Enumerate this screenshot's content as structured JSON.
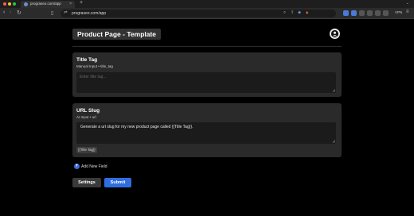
{
  "browser": {
    "tab_title": "prograseo.com/app",
    "tab_close": "×",
    "new_tab": "+",
    "url": "prograseo.com/app",
    "vpn_label": "VPN",
    "traffic_lights": [
      "#ff5f57",
      "#febc2e",
      "#28c840"
    ]
  },
  "page": {
    "title": "Product Page - Template"
  },
  "cards": [
    {
      "label": "Title Tag",
      "subtitle": "Manual Input • title_tag",
      "placeholder": "Enter title tag...",
      "value": ""
    },
    {
      "label": "URL Slug",
      "subtitle": "AI Input • url",
      "value": "Generate a url slug for my new product page called {{Title Tag}}.",
      "chip": "{{Title Tag}}"
    }
  ],
  "actions": {
    "add_field_icon": "+",
    "add_field_label": "Add New Field",
    "settings_label": "Settings",
    "submit_label": "Submit"
  },
  "colors": {
    "accent": "#2f6de0",
    "page_bg": "#000000",
    "card_bg": "#2a2a2a"
  }
}
